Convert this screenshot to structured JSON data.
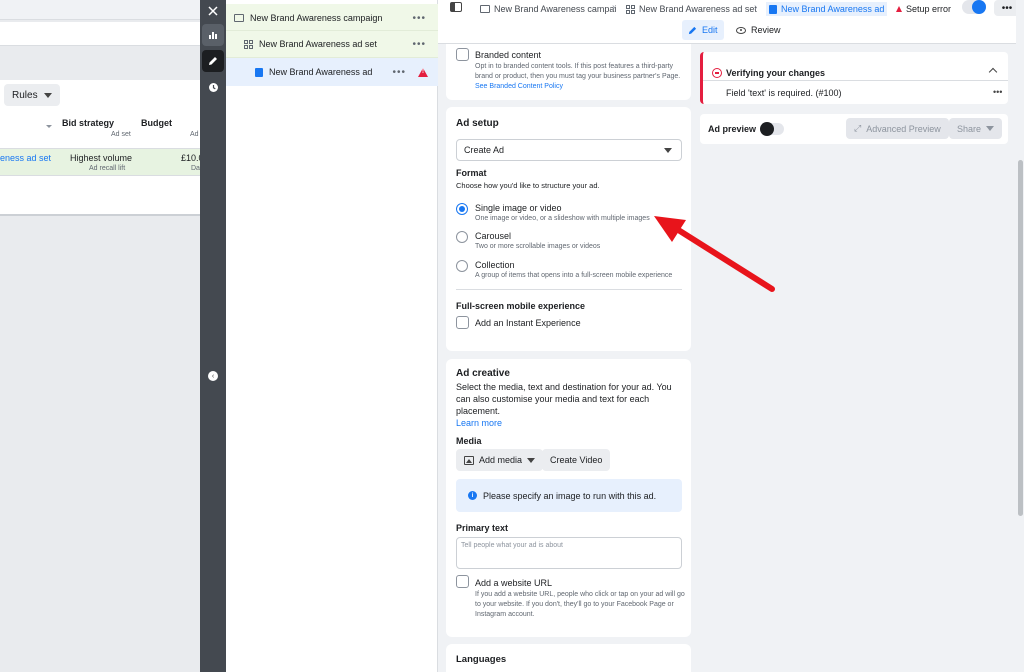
{
  "background": {
    "rules_label": "Rules",
    "table": {
      "headers": [
        {
          "label": "Bid strategy",
          "sub": "Ad set"
        },
        {
          "label": "Budget",
          "sub": "Ad"
        }
      ],
      "row": {
        "name": "eness ad set",
        "bid_strategy": "Highest volume",
        "bid_sub": "Ad recall lift",
        "budget": "£10.0",
        "budget_sub": "Da"
      }
    }
  },
  "toolbar": {
    "icons": [
      "close-icon",
      "chart-icon",
      "pencil-icon",
      "clock-icon"
    ]
  },
  "tree": {
    "campaign": "New Brand Awareness campaign",
    "adset": "New Brand Awareness ad set",
    "ad": "New Brand Awareness ad",
    "more": "•••"
  },
  "topbar": {
    "breadcrumbs": [
      "New Brand Awareness campai",
      "New Brand Awareness ad set",
      "New Brand Awareness ad"
    ],
    "setup_error": "Setup error",
    "more": "•••",
    "tabs": {
      "edit": "Edit",
      "review": "Review"
    }
  },
  "branded": {
    "title": "Branded content",
    "desc": "Opt in to branded content tools. If this post features a third-party brand or product, then you must tag your business partner's Page.",
    "link": "See Branded Content Policy"
  },
  "ad_setup": {
    "title": "Ad setup",
    "select_value": "Create Ad",
    "format_label": "Format",
    "format_desc": "Choose how you'd like to structure your ad.",
    "options": [
      {
        "label": "Single image or video",
        "desc": "One image or video, or a slideshow with multiple images",
        "checked": true
      },
      {
        "label": "Carousel",
        "desc": "Two or more scrollable images or videos",
        "checked": false
      },
      {
        "label": "Collection",
        "desc": "A group of items that opens into a full-screen mobile experience",
        "checked": false
      }
    ],
    "fullscreen_label": "Full-screen mobile experience",
    "instant_label": "Add an Instant Experience"
  },
  "ad_creative": {
    "title": "Ad creative",
    "desc": "Select the media, text and destination for your ad. You can also customise your media and text for each placement.",
    "learn_more": "Learn more",
    "media_label": "Media",
    "add_media": "Add media",
    "create_video": "Create Video",
    "info": "Please specify an image to run with this ad.",
    "primary_text_label": "Primary text",
    "primary_text_placeholder": "Tell people what your ad is about",
    "website_label": "Add a website URL",
    "website_desc": "If you add a website URL, people who click or tap on your ad will go to your website. If you don't, they'll go to your Facebook Page or Instagram account."
  },
  "languages": {
    "title": "Languages"
  },
  "verify": {
    "title": "Verifying your changes",
    "message": "Field 'text' is required. (#100)",
    "more": "•••"
  },
  "preview": {
    "label": "Ad preview",
    "advanced": "Advanced Preview",
    "share": "Share"
  },
  "colors": {
    "accent": "#1877f2",
    "error": "#e41e3f",
    "arrow": "#e8141b"
  }
}
